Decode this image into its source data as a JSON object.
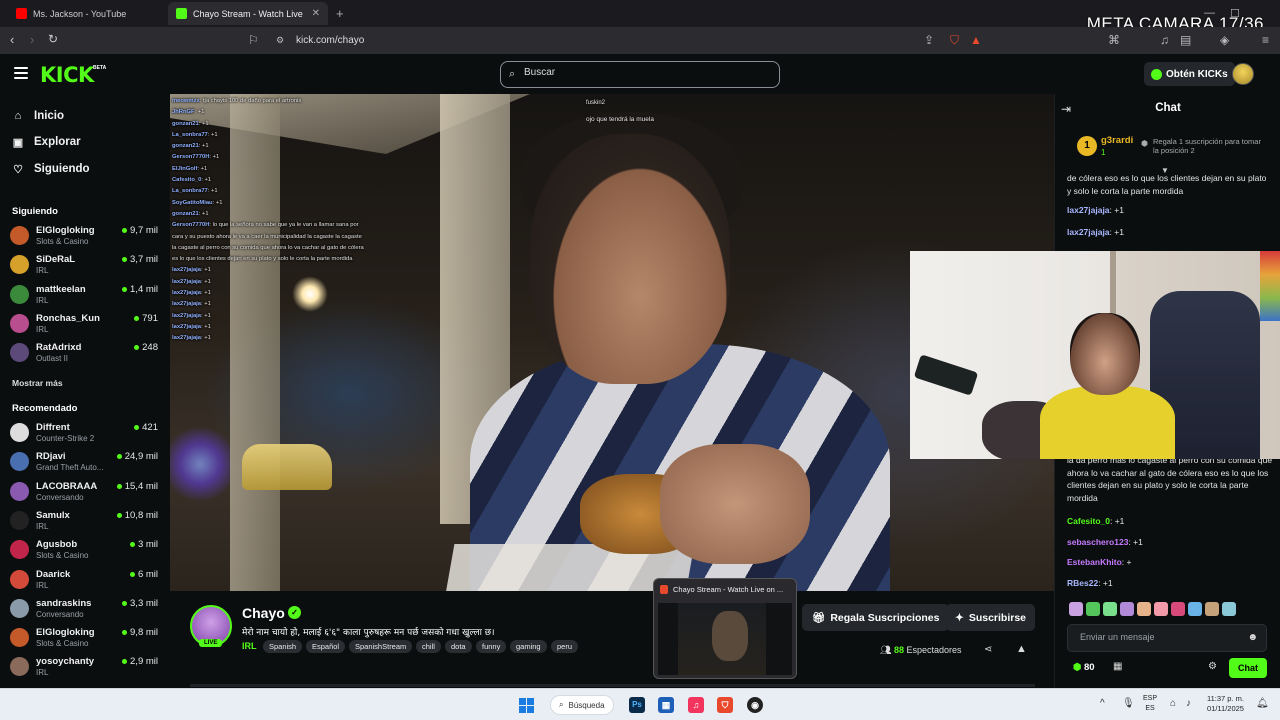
{
  "browser": {
    "tabs": [
      {
        "title": "Ms. Jackson - YouTube",
        "active": false
      },
      {
        "title": "Chayo Stream - Watch Live on K",
        "active": true
      }
    ],
    "new_tab": "+",
    "url": "kick.com/chayo",
    "overlay_text": "META CAMARA 17/36"
  },
  "header": {
    "logo": "KICK",
    "logo_badge": "BETA",
    "search_placeholder": "Buscar",
    "get_kicks": "Obtén KICKs"
  },
  "sidebar": {
    "nav": [
      {
        "label": "Inicio",
        "icon": "home-icon"
      },
      {
        "label": "Explorar",
        "icon": "compass-icon"
      },
      {
        "label": "Siguiendo",
        "icon": "heart-icon"
      }
    ],
    "following_title": "Siguiendo",
    "following": [
      {
        "name": "ElGlogloking",
        "category": "Slots & Casino",
        "viewers": "9,7 mil",
        "color": "#c45a2a"
      },
      {
        "name": "SiDeRaL",
        "category": "IRL",
        "viewers": "3,7 mil",
        "color": "#d6a12a"
      },
      {
        "name": "mattkeelan",
        "category": "IRL",
        "viewers": "1,4 mil",
        "color": "#3b8a3b"
      },
      {
        "name": "Ronchas_Kun",
        "category": "IRL",
        "viewers": "791",
        "color": "#b94e8e"
      },
      {
        "name": "RatAdrixd",
        "category": "Outlast II",
        "viewers": "248",
        "color": "#5b4a7a"
      }
    ],
    "show_more": "Mostrar más",
    "recommended_title": "Recomendado",
    "recommended": [
      {
        "name": "Diffrent",
        "category": "Counter-Strike 2",
        "viewers": "421",
        "color": "#dddddd"
      },
      {
        "name": "RDjavi",
        "category": "Grand Theft Auto...",
        "viewers": "24,9 mil",
        "color": "#4a6fb0"
      },
      {
        "name": "LACOBRAAA",
        "category": "Conversando",
        "viewers": "15,4 mil",
        "color": "#8a5ab0"
      },
      {
        "name": "Samulx",
        "category": "IRL",
        "viewers": "10,8 mil",
        "color": "#222222"
      },
      {
        "name": "Agusbob",
        "category": "Slots & Casino",
        "viewers": "3 mil",
        "color": "#c2254a"
      },
      {
        "name": "Daarick",
        "category": "IRL",
        "viewers": "6 mil",
        "color": "#d44a3a"
      },
      {
        "name": "sandraskins",
        "category": "Conversando",
        "viewers": "3,3 mil",
        "color": "#8a9aa8"
      },
      {
        "name": "ElGlogloking",
        "category": "Slots & Casino",
        "viewers": "9,8 mil",
        "color": "#c45a2a"
      },
      {
        "name": "yosoychanty",
        "category": "IRL",
        "viewers": "2,9 mil",
        "color": "#8a6a5a"
      }
    ]
  },
  "video_overlay": {
    "chat_lines": [
      {
        "user": "meowmzx",
        "text": ": tja chayis 100 de daño para el artronis"
      },
      {
        "user": "JhRnGF",
        "text": ": +1"
      },
      {
        "user": "gonzan21",
        "text": ": +1"
      },
      {
        "user": "La_sonbra77",
        "text": ": +1"
      },
      {
        "user": "gonzan21",
        "text": ": +1"
      },
      {
        "user": "Gerson7770H",
        "text": ": +1"
      },
      {
        "user": "ElJinGolf",
        "text": ": +1"
      },
      {
        "user": "Cafesito_0",
        "text": ": +1"
      },
      {
        "user": "La_sonbra77",
        "text": ": +1"
      },
      {
        "user": "SoyGatitoMiau",
        "text": ": +1"
      },
      {
        "user": "gonzan21",
        "text": ": +1"
      },
      {
        "user": "Gerson7770H",
        "text": ": lo que la señora no sabe que ya le van a llamar sana por"
      },
      {
        "user": "",
        "text": "cara y su puesto ahora le va a caer la municipalidad la cagaste la cagaste"
      },
      {
        "user": "",
        "text": "la cagaste al perro con su comida que ahora lo va cachar al gato de cólera"
      },
      {
        "user": "",
        "text": "es lo que los clientes dejan en su plato y solo le corta la parte mordida"
      },
      {
        "user": "lax27jajaja",
        "text": ": +1"
      },
      {
        "user": "lax27jajaja",
        "text": ": +1"
      },
      {
        "user": "lax27jajaja",
        "text": ": +1"
      },
      {
        "user": "lax27jajaja",
        "text": ": +1"
      },
      {
        "user": "lax27jajaja",
        "text": ": +1"
      },
      {
        "user": "lax27jajaja",
        "text": ": +1"
      },
      {
        "user": "lax27jajaja",
        "text": ": +1"
      }
    ],
    "top_user": "fuskin2",
    "caption": "ojo que tendrá la muela"
  },
  "stream": {
    "channel": "Chayo",
    "live_badge": "LIVE",
    "title": "मेरो नाम चायो हो, मलाई ६'६\" काला पुरुषहरू मन पर्छ जसको गधा खुल्ला छ।",
    "category": "IRL",
    "tags": [
      "Spanish",
      "Español",
      "SpanishStream",
      "chill",
      "dota",
      "funny",
      "gaming",
      "peru"
    ],
    "gift_label": "Regala Suscripciones",
    "subscribe_label": "Suscribirse",
    "viewers_count": "88",
    "viewers_label": "Espectadores"
  },
  "chat": {
    "title": "Chat",
    "pinned": {
      "rank": "1",
      "user": "g3rardi",
      "count": "1",
      "gift_text": "Regala 1 suscripción para tomar la posición 2"
    },
    "messages_top": [
      {
        "user": "",
        "text": "de cólera eso es lo que los clientes dejan en su plato y solo le corta la parte mordida"
      },
      {
        "user": "lax27jajaja",
        "text": ": +1",
        "color": "#a9b7ff"
      },
      {
        "user": "lax27jajaja",
        "text": ": +1",
        "color": "#a9b7ff"
      }
    ],
    "messages_bottom": [
      {
        "user": "",
        "text": "la da perro más lo cagaste al perro con su comida que ahora lo va cachar al gato de cólera eso es lo que los clientes dejan en su plato y solo le corta la parte mordida",
        "color": "#e4e4e4"
      },
      {
        "user": "Cafesito_0",
        "text": ": +1",
        "color": "#53fc18"
      },
      {
        "user": "sebaschero123",
        "text": ": +1",
        "color": "#c67bff"
      },
      {
        "user": "EstebanKhito",
        "text": ": +",
        "color": "#c67bff"
      },
      {
        "user": "RBes22",
        "text": ": +1",
        "color": "#a9b7ff"
      }
    ],
    "input_placeholder": "Enviar un mensaje",
    "kicks": "80",
    "send_label": "Chat"
  },
  "preview_popup": {
    "title": "Chayo Stream - Watch Live on ..."
  },
  "taskbar": {
    "search_label": "Búsqueda",
    "lang_top": "ESP",
    "lang_bottom": "ES",
    "time": "11:37 p. m.",
    "date": "01/11/2025"
  }
}
